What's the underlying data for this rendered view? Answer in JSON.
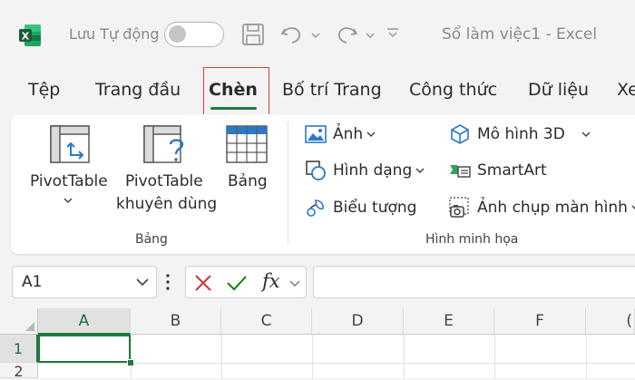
{
  "titlebar": {
    "autosave_label": "Lưu Tự động",
    "doc_title": "Sổ làm việc1  -  Excel"
  },
  "tabs": [
    {
      "label": "Tệp"
    },
    {
      "label": "Trang đầu"
    },
    {
      "label": "Chèn"
    },
    {
      "label": "Bố trí Trang"
    },
    {
      "label": "Công thức"
    },
    {
      "label": "Dữ liệu"
    },
    {
      "label": "Xe"
    }
  ],
  "ribbon": {
    "tables_group": {
      "pivottable_label": "PivotTable",
      "recommended_line1": "PivotTable",
      "recommended_line2": "khuyên dùng",
      "table_label": "Bảng",
      "group_label": "Bảng"
    },
    "illustrations_group": {
      "picture": "Ảnh",
      "shapes": "Hình dạng",
      "icons": "Biểu tượng",
      "model3d": "Mô hình 3D",
      "smartart": "SmartArt",
      "screenshot": "Ảnh chụp màn hình",
      "group_label": "Hình minh họa"
    }
  },
  "formula_bar": {
    "name_box": "A1",
    "fx": "fx"
  },
  "grid": {
    "columns": [
      "A",
      "B",
      "C",
      "D",
      "E",
      "F"
    ],
    "rows": [
      "1",
      "2"
    ]
  },
  "colors": {
    "accent_green": "#1f7a3c",
    "highlight_red": "#e03a3a",
    "cancel_red": "#d13438",
    "confirm_green": "#107c10"
  }
}
